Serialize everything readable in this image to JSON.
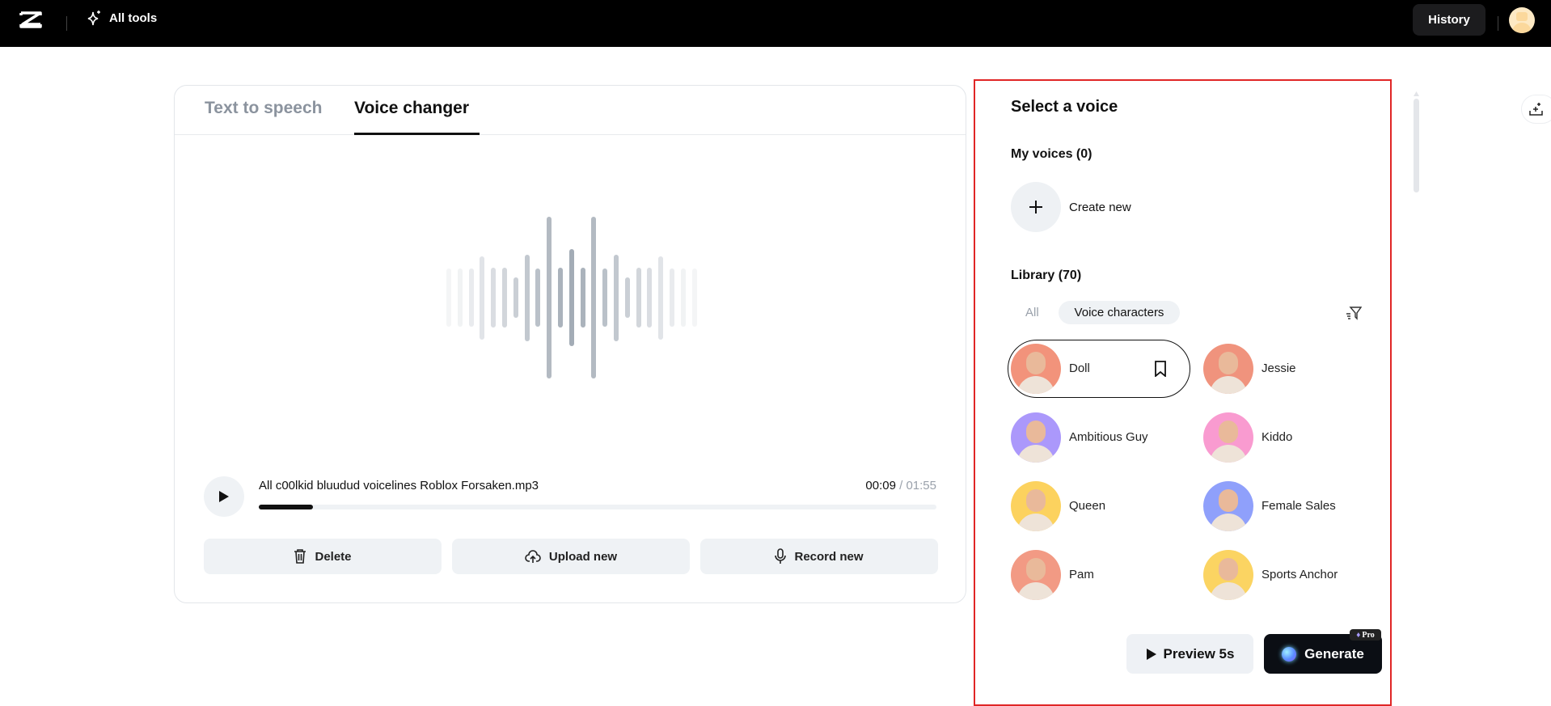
{
  "topbar": {
    "all_tools": "All tools",
    "history": "History"
  },
  "tabs": [
    {
      "label": "Text to speech",
      "active": false
    },
    {
      "label": "Voice changer",
      "active": true
    }
  ],
  "player": {
    "filename": "All c00lkid bluudud voicelines Roblox Forsaken.mp3",
    "current": "00:09",
    "total": "/ 01:55",
    "progress": 0.08
  },
  "actions": {
    "delete": "Delete",
    "upload": "Upload new",
    "record": "Record new"
  },
  "panel": {
    "title": "Select a voice",
    "my_voices": "My voices (0)",
    "create_new": "Create new",
    "library": "Library (70)",
    "filters": {
      "all": "All",
      "voice_characters": "Voice characters"
    },
    "voices": [
      {
        "name": "Doll",
        "color": "#f2937b",
        "selected": true
      },
      {
        "name": "Jessie",
        "color": "#f0937d"
      },
      {
        "name": "Ambitious Guy",
        "color": "#ab98fb"
      },
      {
        "name": "Kiddo",
        "color": "#f99bd0"
      },
      {
        "name": "Queen",
        "color": "#fcd25e"
      },
      {
        "name": "Female Sales",
        "color": "#8fa0fb"
      },
      {
        "name": "Pam",
        "color": "#f29a84"
      },
      {
        "name": "Sports Anchor",
        "color": "#fbd462"
      }
    ],
    "preview": "Preview 5s",
    "generate": "Generate",
    "pro_badge": "Pro"
  }
}
